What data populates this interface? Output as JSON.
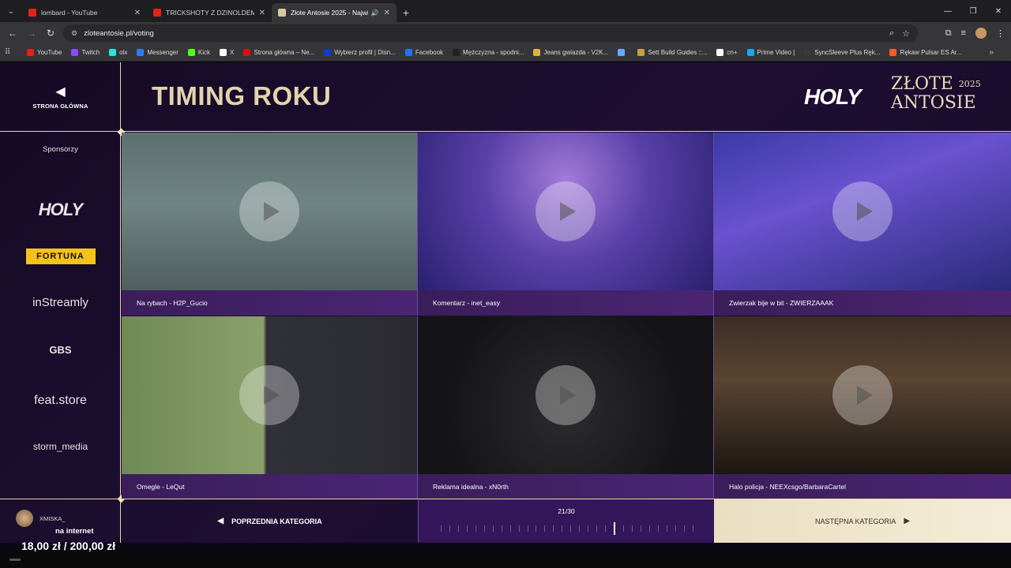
{
  "browser": {
    "tabs": [
      {
        "label": "lombard - YouTube",
        "color": "#e62117"
      },
      {
        "label": "TRICKSHOTY Z DZINOLDEMI -",
        "color": "#e62117"
      },
      {
        "label": "Złote Antosie 2025 - Najwi",
        "color": "#d8c8a0"
      }
    ],
    "url": "zloteantosie.pl/voting",
    "bookmarks": [
      {
        "label": "YouTube",
        "color": "#e62117"
      },
      {
        "label": "Twitch",
        "color": "#9146ff"
      },
      {
        "label": "olx",
        "color": "#23e5db"
      },
      {
        "label": "Messenger",
        "color": "#2e7bf6"
      },
      {
        "label": "Kick",
        "color": "#53fc18"
      },
      {
        "label": "X",
        "color": "#ffffff"
      },
      {
        "label": "Strona główna – Ne...",
        "color": "#e50914"
      },
      {
        "label": "Wybierz profil | Disn...",
        "color": "#113ccf"
      },
      {
        "label": "Facebook",
        "color": "#1877f2"
      },
      {
        "label": "Mężczyzna - spodni...",
        "color": "#222222"
      },
      {
        "label": "Jeans gwiazda - V2K...",
        "color": "#d9b640"
      },
      {
        "label": "",
        "color": "#6aa8ff"
      },
      {
        "label": "Sett Build Guides ::...",
        "color": "#c8a040"
      },
      {
        "label": "cn+",
        "color": "#ffffff"
      },
      {
        "label": "Prime Video |",
        "color": "#1aa7ec"
      },
      {
        "label": "SyncSleeve Plus Ręk...",
        "color": "#3a3a3a"
      },
      {
        "label": "Rękaw Pulsar ES Ar...",
        "color": "#ff5a1f"
      }
    ]
  },
  "nav": {
    "home_label": "STRONA GŁÓWNA",
    "sponsors_title": "Sponsorzy",
    "sponsors": [
      "HOLY",
      "FORTUNA",
      "inStreamly",
      "GBS",
      "feat.store",
      "storm_media"
    ]
  },
  "header": {
    "title": "TIMING ROKU",
    "logo_brand": "HOLY",
    "logo_line1": "ZŁOTE",
    "logo_year": "2025",
    "logo_line2": "ANTOSIE"
  },
  "cards": [
    {
      "caption": "Na rybach - H2P_Gucio"
    },
    {
      "caption": "Komentarz - inet_easy"
    },
    {
      "caption": "Zwierzak bije w bit - ZWIERZAAAK"
    },
    {
      "caption": "Omegle - LeQut"
    },
    {
      "caption": "Reklama idealna - xN0rth"
    },
    {
      "caption": "Halo policja - NEEXcsgo/BarbaraCartel"
    }
  ],
  "footer": {
    "user": "XMISKA_",
    "prev_label": "POPRZEDNIA KATEGORIA",
    "progress_text": "21/30",
    "progress_current": 21,
    "progress_total": 30,
    "next_label": "NASTĘPNA KATEGORIA"
  },
  "overlay": {
    "line1": "na internet",
    "line2": "18,00 zł / 200,00 zł"
  }
}
